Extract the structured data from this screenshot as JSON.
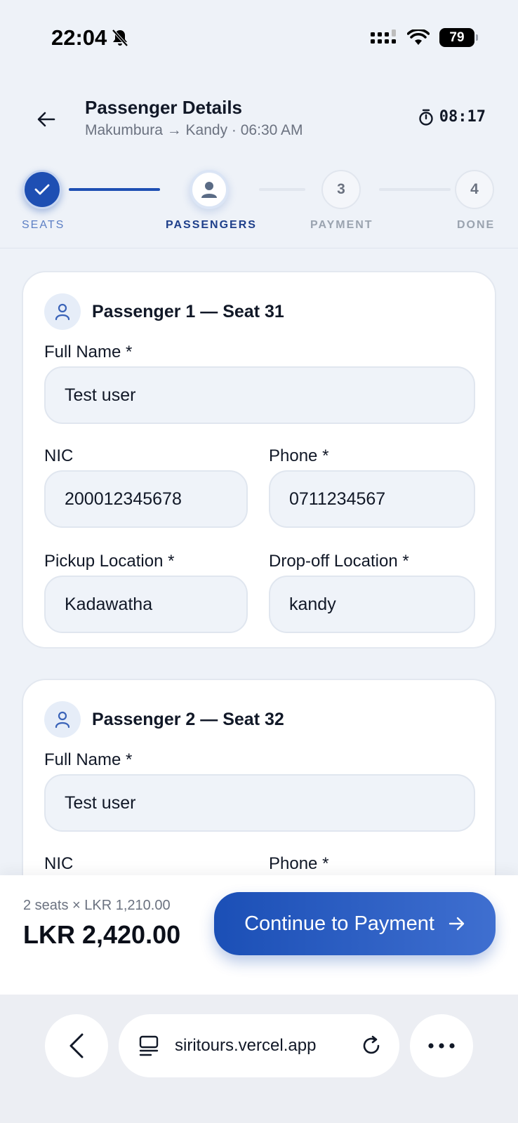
{
  "status_bar": {
    "time": "22:04",
    "battery": "79"
  },
  "header": {
    "title": "Passenger Details",
    "subtitle": "Makumbura → Kandy · 06:30 AM",
    "timer": "08:17"
  },
  "stepper": {
    "steps": [
      {
        "label": "SEATS",
        "state": "complete"
      },
      {
        "label": "PASSENGERS",
        "state": "active"
      },
      {
        "label": "PAYMENT",
        "state": "pending",
        "number": "3"
      },
      {
        "label": "DONE",
        "state": "pending",
        "number": "4"
      }
    ]
  },
  "passengers": [
    {
      "title": "Passenger 1 — Seat 31",
      "full_name_label": "Full Name *",
      "full_name": "Test user",
      "nic_label": "NIC",
      "nic": "200012345678",
      "phone_label": "Phone *",
      "phone": "0711234567",
      "pickup_label": "Pickup Location *",
      "pickup": "Kadawatha",
      "dropoff_label": "Drop-off Location *",
      "dropoff": "kandy"
    },
    {
      "title": "Passenger 2 — Seat 32",
      "full_name_label": "Full Name *",
      "full_name": "Test user",
      "nic_label": "NIC",
      "phone_label": "Phone *"
    }
  ],
  "summary": {
    "breakdown": "2 seats × LKR 1,210.00",
    "total": "LKR 2,420.00",
    "cta_label": "Continue to Payment"
  },
  "browser": {
    "url": "siritours.vercel.app"
  },
  "colors": {
    "primary": "#1e4fb3",
    "background": "#eef2f8",
    "input_bg": "#eff3f9"
  }
}
